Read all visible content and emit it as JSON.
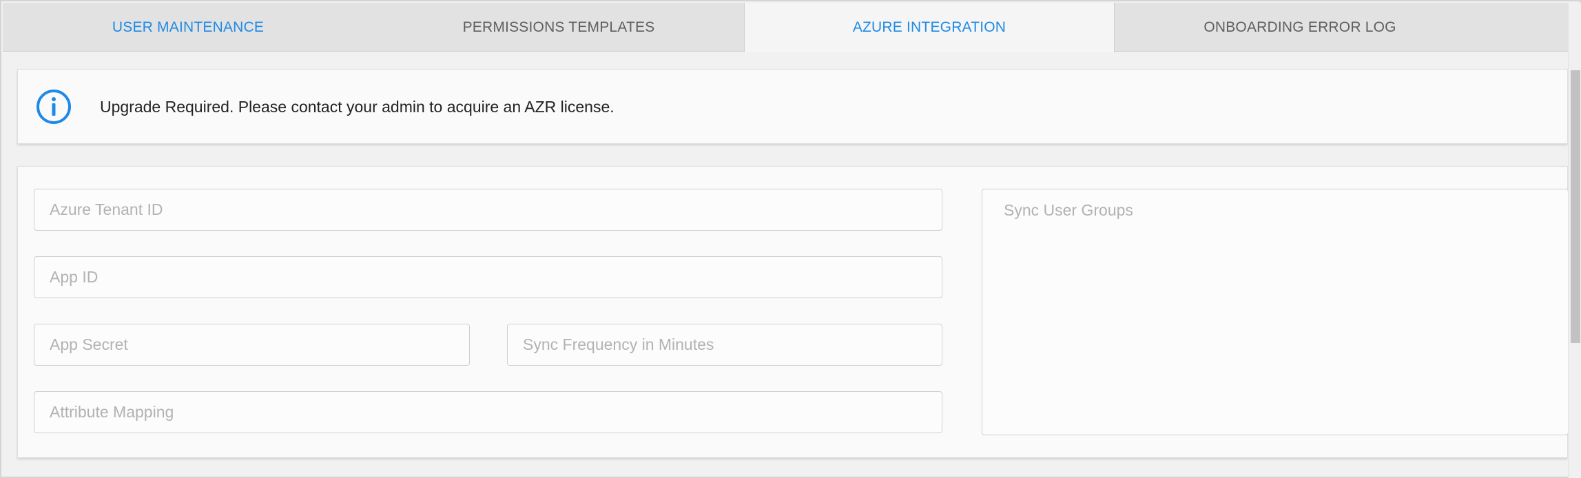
{
  "tabs": [
    {
      "label": "USER MAINTENANCE",
      "active": false
    },
    {
      "label": "PERMISSIONS TEMPLATES",
      "active": false
    },
    {
      "label": "AZURE INTEGRATION",
      "active": true
    },
    {
      "label": "ONBOARDING ERROR LOG",
      "active": false
    }
  ],
  "banner": {
    "icon": "info-icon",
    "message": "Upgrade Required. Please contact your admin to acquire an AZR license."
  },
  "form": {
    "azure_tenant_id": {
      "placeholder": "Azure Tenant ID",
      "value": ""
    },
    "app_id": {
      "placeholder": "App ID",
      "value": ""
    },
    "app_secret": {
      "placeholder": "App Secret",
      "value": ""
    },
    "sync_frequency": {
      "placeholder": "Sync Frequency in Minutes",
      "value": ""
    },
    "attribute_mapping": {
      "placeholder": "Attribute Mapping",
      "value": ""
    },
    "sync_user_groups": {
      "placeholder": "Sync User Groups",
      "value": ""
    }
  },
  "colors": {
    "accent": "#1f8ae6",
    "tab_text": "#5f5f5f",
    "placeholder": "#b2b2b2"
  }
}
